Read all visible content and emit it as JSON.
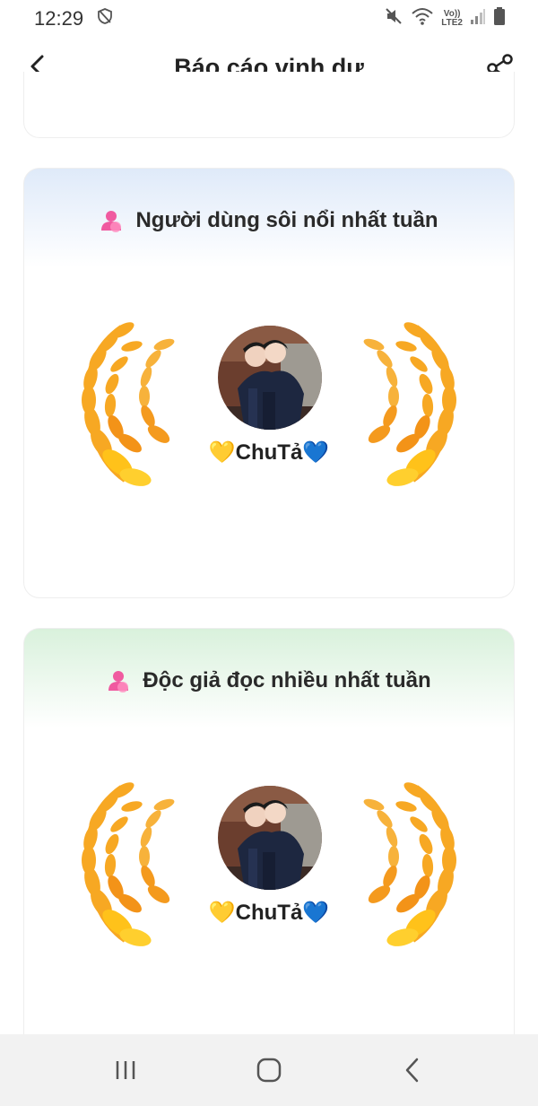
{
  "status_bar": {
    "time": "12:29",
    "network_top": "Vo))",
    "network_bottom": "LTE2",
    "icons": [
      "shield-icon",
      "mute-icon",
      "wifi-icon",
      "signal-icon",
      "battery-icon"
    ]
  },
  "header": {
    "title": "Báo cáo vinh dự",
    "back_icon": "back-arrow-icon",
    "share_icon": "share-icon"
  },
  "cards": [
    {
      "title": "Người dùng sôi nổi nhất tuần",
      "user_name": "ChuTả",
      "header_color": "#dfeaf9"
    },
    {
      "title": "Độc giả đọc nhiều nhất tuần",
      "user_name": "ChuTả",
      "header_color": "#d9f1dc"
    }
  ],
  "decor": {
    "heart_left": "💛",
    "heart_right": "💙",
    "wreath_color": "#f7a823"
  },
  "bottom_nav": [
    "recents-icon",
    "home-icon",
    "back-icon"
  ]
}
